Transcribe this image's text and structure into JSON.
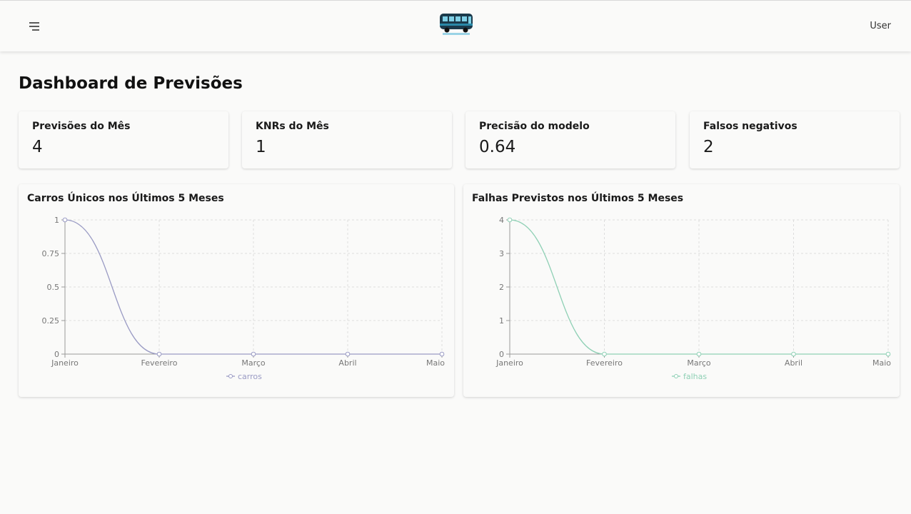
{
  "app": {
    "user_label": "User"
  },
  "icons": {
    "menu": "menu-icon",
    "logo": "bus-logo"
  },
  "page": {
    "title": "Dashboard de Previsões"
  },
  "stats": [
    {
      "label": "Previsões do Mês",
      "value": "4"
    },
    {
      "label": "KNRs do Mês",
      "value": "1"
    },
    {
      "label": "Precisão do modelo",
      "value": "0.64"
    },
    {
      "label": "Falsos negativos",
      "value": "2"
    }
  ],
  "colors": {
    "carros": "#9a9bc4",
    "falhas": "#8fd0b5",
    "axis": "#999999",
    "grid": "#dddddd"
  },
  "chart_data": [
    {
      "type": "line",
      "title": "Carros Únicos nos Últimos 5 Meses",
      "categories": [
        "Janeiro",
        "Fevereiro",
        "Março",
        "Abril",
        "Maio"
      ],
      "series": [
        {
          "name": "carros",
          "values": [
            1,
            0,
            0,
            0,
            0
          ]
        }
      ],
      "yticks": [
        "0",
        "0.25",
        "0.5",
        "0.75",
        "1"
      ],
      "ylim": [
        0,
        1
      ],
      "grid": true,
      "legend": "bottom"
    },
    {
      "type": "line",
      "title": "Falhas Previstos nos Últimos 5 Meses",
      "categories": [
        "Janeiro",
        "Fevereiro",
        "Março",
        "Abril",
        "Maio"
      ],
      "series": [
        {
          "name": "falhas",
          "values": [
            4,
            0,
            0,
            0,
            0
          ]
        }
      ],
      "yticks": [
        "0",
        "1",
        "2",
        "3",
        "4"
      ],
      "ylim": [
        0,
        4
      ],
      "grid": true,
      "legend": "bottom"
    }
  ]
}
